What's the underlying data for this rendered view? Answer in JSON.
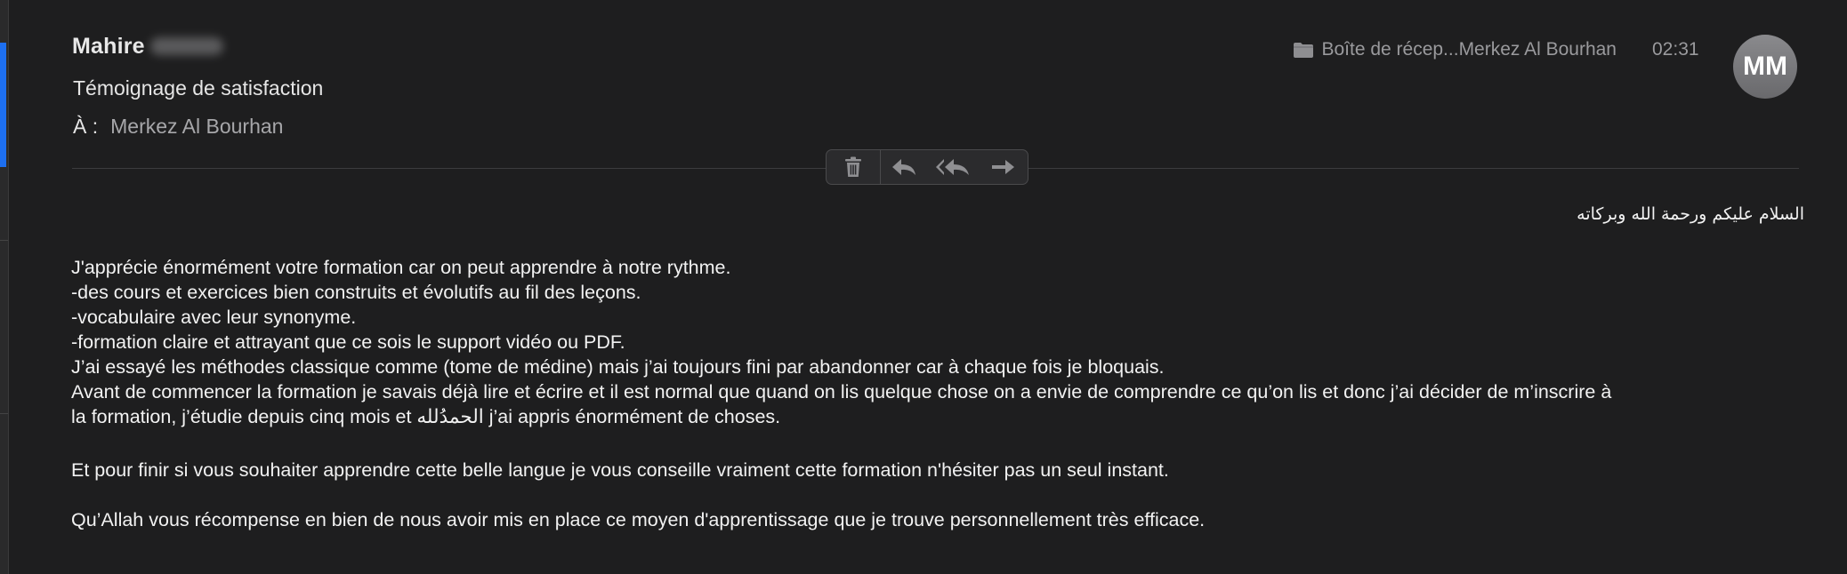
{
  "header": {
    "sender_name": "Mahire",
    "subject": "Témoignage de satisfaction",
    "to_label": "À :",
    "to_value": "Merkez Al Bourhan",
    "mailbox": "Boîte de récep...Merkez Al Bourhan",
    "time": "02:31",
    "avatar_initials": "MM"
  },
  "toolbar": {
    "icons": [
      "trash-icon",
      "reply-icon",
      "reply-all-icon",
      "forward-icon"
    ]
  },
  "message": {
    "greeting": "السلام عليكم ورحمة الله وبركاته",
    "lines": [
      "J'apprécie énormément votre formation car on peut apprendre à notre rythme.",
      "-des cours et  exercices bien construits et évolutifs au fil des leçons.",
      "-vocabulaire avec leur synonyme.",
      "-formation claire et attrayant que ce sois le support vidéo ou PDF.",
      "J’ai essayé les méthodes classique comme (tome de médine) mais j’ai toujours fini par abandonner car à chaque fois je bloquais.",
      "Avant de commencer la formation je savais déjà lire et écrire et il est normal que quand on lis quelque chose on a envie de comprendre ce qu’on lis et donc j’ai décider de m’inscrire à",
      "la formation, j’étudie depuis cinq mois et الحمدُلله j’ai appris énormément de choses."
    ],
    "paragraph2": "Et pour finir si vous souhaiter apprendre cette belle langue  je vous conseille vraiment cette formation n'hésiter pas un seul instant.",
    "paragraph3": "Qu’Allah vous récompense en bien de nous avoir mis en place ce moyen d'apprentissage que je trouve personnellement très efficace."
  },
  "colors": {
    "background": "#1e1e1f",
    "accent": "#1d6ff0",
    "muted_text": "#9a9a9d"
  }
}
